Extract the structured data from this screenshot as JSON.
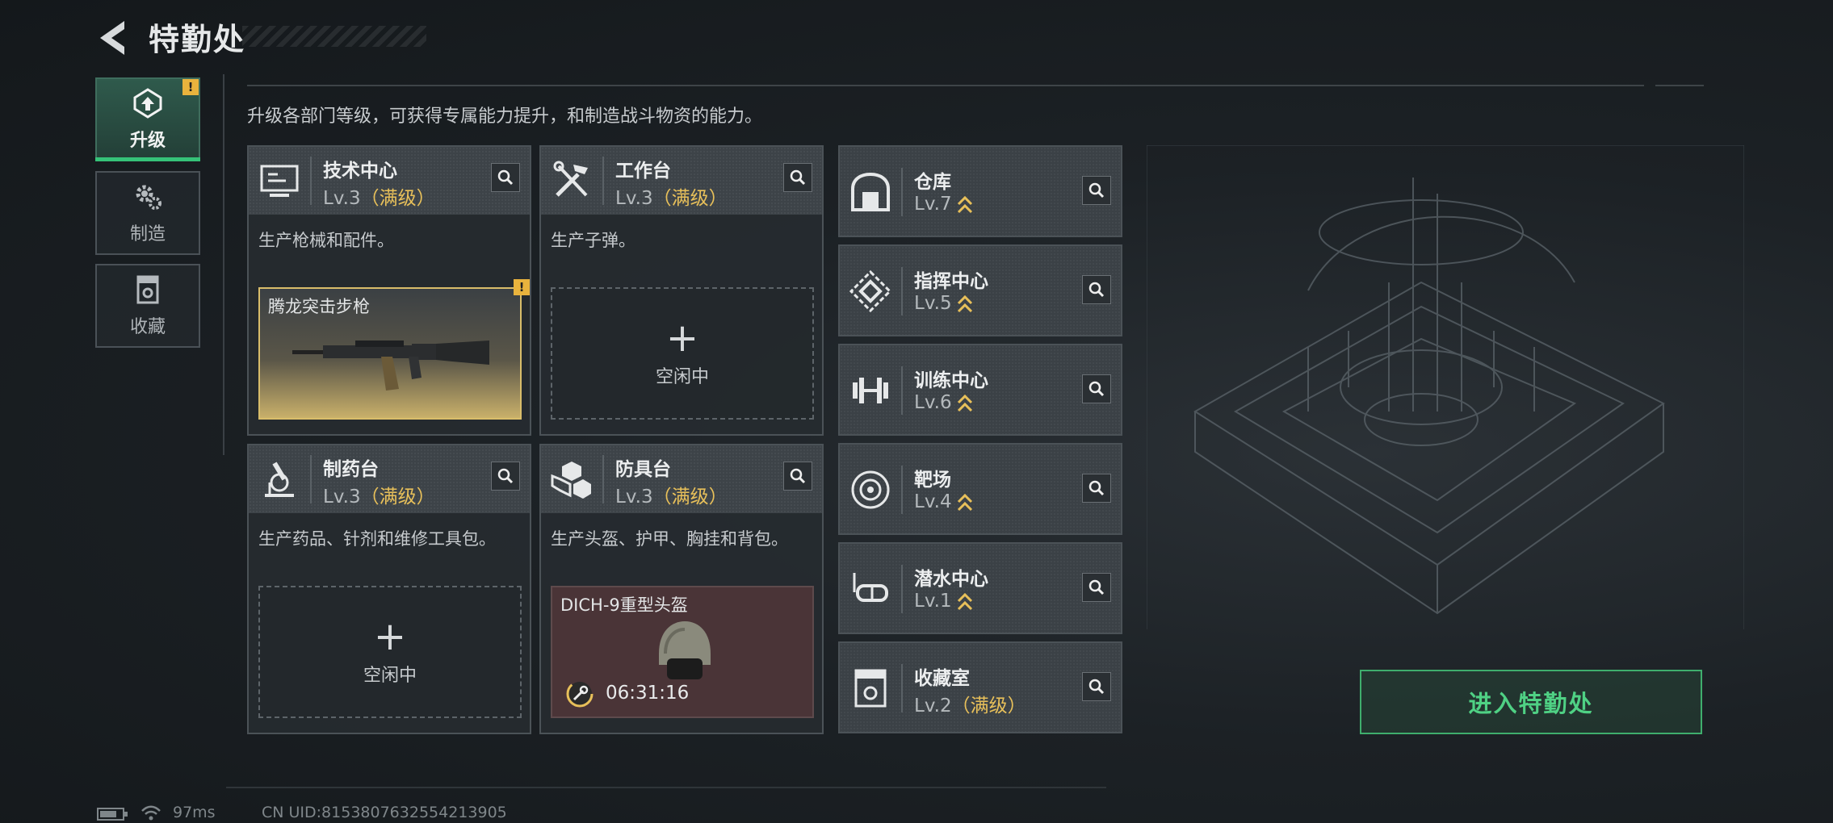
{
  "header": {
    "title": "特勤处"
  },
  "tabs": [
    {
      "label": "升级",
      "active": true,
      "alert": "!"
    },
    {
      "label": "制造",
      "active": false
    },
    {
      "label": "收藏",
      "active": false
    }
  ],
  "description": "升级各部门等级，可获得专属能力提升，和制造战斗物资的能力。",
  "departments": [
    {
      "name": "技术中心",
      "level": "Lv.3",
      "status": "（满级）",
      "desc": "生产枪械和配件。",
      "slot_title": "腾龙突击步枪",
      "alert": "!"
    },
    {
      "name": "工作台",
      "level": "Lv.3",
      "status": "（满级）",
      "desc": "生产子弹。",
      "idle_plus": "+",
      "idle_text": "空闲中"
    },
    {
      "name": "制药台",
      "level": "Lv.3",
      "status": "（满级）",
      "desc": "生产药品、针剂和维修工具包。",
      "idle_plus": "+",
      "idle_text": "空闲中"
    },
    {
      "name": "防具台",
      "level": "Lv.3",
      "status": "（满级）",
      "desc": "生产头盔、护甲、胸挂和背包。",
      "slot_title": "DICH-9重型头盔",
      "timer": "06:31:16"
    }
  ],
  "facilities": [
    {
      "name": "仓库",
      "level": "Lv.7",
      "upgradable": true
    },
    {
      "name": "指挥中心",
      "level": "Lv.5",
      "upgradable": true
    },
    {
      "name": "训练中心",
      "level": "Lv.6",
      "upgradable": true
    },
    {
      "name": "靶场",
      "level": "Lv.4",
      "upgradable": true
    },
    {
      "name": "潜水中心",
      "level": "Lv.1",
      "upgradable": true
    },
    {
      "name": "收藏室",
      "level": "Lv.2",
      "status": "（满级）",
      "upgradable": false
    }
  ],
  "enter_button": "进入特勤处",
  "footer": {
    "ping": "97ms",
    "uid": "CN UID:8153807632554213905"
  },
  "colors": {
    "accent_green": "#35c278",
    "maxed_gold": "#e8c05a",
    "alert_yellow": "#e9b33d"
  }
}
